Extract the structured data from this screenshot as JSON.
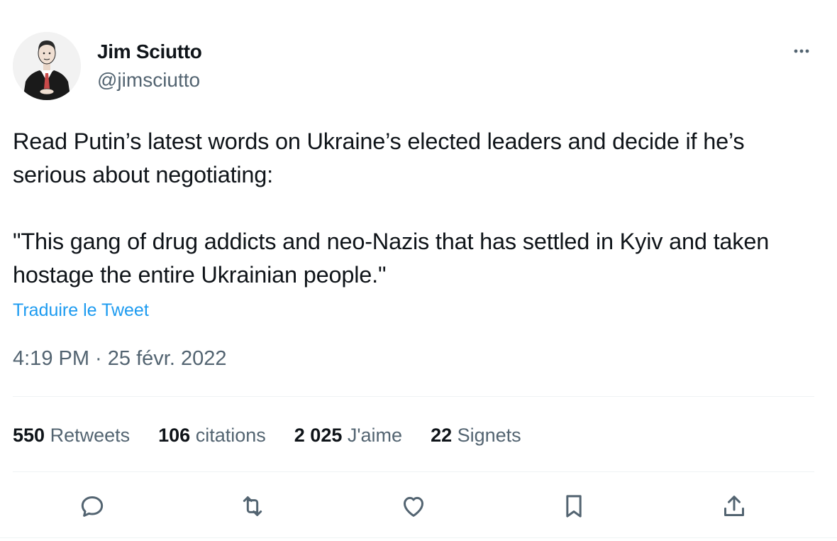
{
  "author": {
    "name": "Jim Sciutto",
    "handle": "@jimsciutto",
    "avatar_icon": "caricature-avatar"
  },
  "menu": {
    "more_icon": "more-horizontal-icon"
  },
  "tweet": {
    "paragraphs": [
      "Read Putin’s latest words on Ukraine’s elected leaders and decide if he’s serious about negotiating:",
      "\"This gang of drug addicts and neo-Nazis that has settled in Kyiv and taken hostage the entire Ukrainian people.\""
    ],
    "translate_label": "Traduire le Tweet",
    "timestamp": "4:19 PM · 25 févr. 2022"
  },
  "stats": [
    {
      "count": "550",
      "label": "Retweets"
    },
    {
      "count": "106",
      "label": "citations"
    },
    {
      "count": "2 025",
      "label": "J'aime"
    },
    {
      "count": "22",
      "label": "Signets"
    }
  ],
  "actions": [
    {
      "icon": "reply-icon"
    },
    {
      "icon": "retweet-icon"
    },
    {
      "icon": "like-icon"
    },
    {
      "icon": "bookmark-icon"
    },
    {
      "icon": "share-icon"
    }
  ],
  "colors": {
    "text": "#0f1419",
    "secondary": "#536471",
    "link": "#1d9bf0",
    "divider": "#eff3f4"
  }
}
